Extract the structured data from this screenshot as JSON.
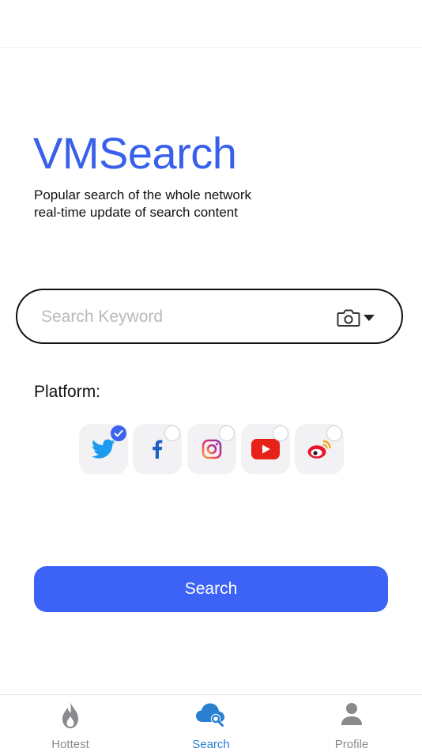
{
  "app": {
    "brand": "VMSearch",
    "tagline_line1": "Popular search of the whole network",
    "tagline_line2": "real-time update of search content"
  },
  "search": {
    "placeholder": "Search Keyword",
    "value": "",
    "camera_icon": "camera-icon",
    "dropdown_icon": "caret-down-icon"
  },
  "platform": {
    "label": "Platform:",
    "options": [
      {
        "name": "twitter",
        "selected": true,
        "color": "#1d9bf0"
      },
      {
        "name": "facebook",
        "selected": false,
        "color": "#1877f2"
      },
      {
        "name": "instagram",
        "selected": false,
        "color": "#c13584"
      },
      {
        "name": "youtube",
        "selected": false,
        "color": "#e62117"
      },
      {
        "name": "weibo",
        "selected": false,
        "color": "#e6162d"
      }
    ]
  },
  "actions": {
    "search_label": "Search"
  },
  "tabs": [
    {
      "label": "Hottest",
      "icon": "flame-icon",
      "active": false
    },
    {
      "label": "Search",
      "icon": "cloud-search-icon",
      "active": true
    },
    {
      "label": "Profile",
      "icon": "person-icon",
      "active": false
    }
  ],
  "colors": {
    "brand": "#3860ea",
    "primary_button": "#3c63f5",
    "active_tab": "#2a7fd0",
    "inactive_tab": "#8a8a8e"
  }
}
